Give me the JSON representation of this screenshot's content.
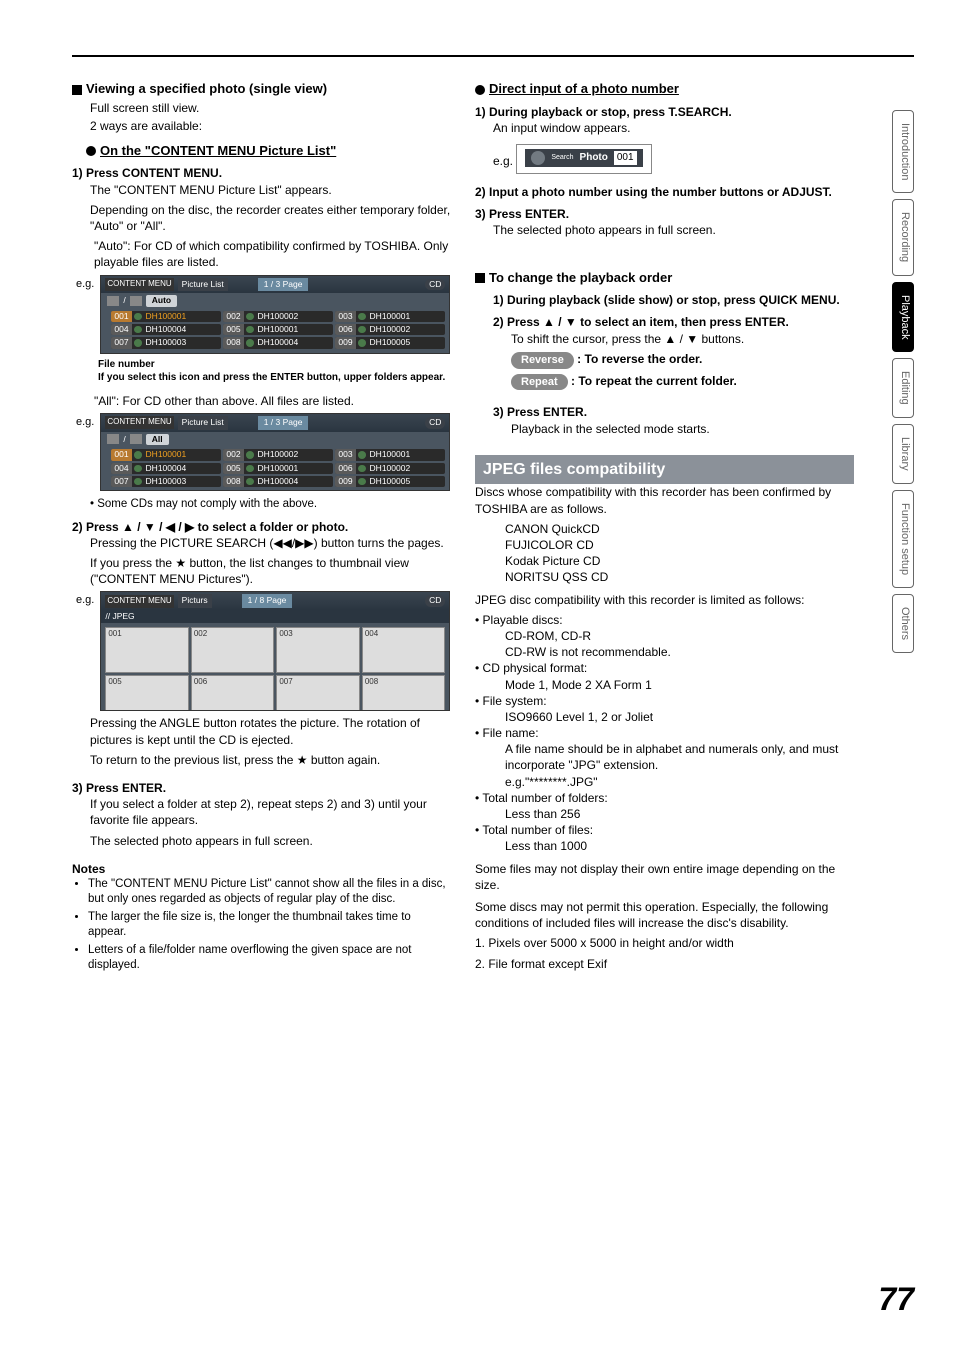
{
  "left": {
    "h_view": "Viewing a specified photo (single view)",
    "sub1": "Full screen still view.",
    "sub2": "2 ways are available:",
    "h_content": "On the \"CONTENT MENU Picture List\"",
    "s1_t": "1)  Press CONTENT MENU.",
    "s1_b1": "The \"CONTENT MENU Picture List\" appears.",
    "s1_b2": "Depending on the disc, the recorder creates either temporary folder, \"Auto\" or \"All\".",
    "s1_auto": "\"Auto\": For CD of which compatibility confirmed by TOSHIBA. Only playable files are listed.",
    "eg": "e.g.",
    "pl_corner": "CONTENT MENU",
    "pl_title": "Picture List",
    "pl_page": "1 / 3",
    "pl_page_lbl": "Page",
    "pl_cd": "CD",
    "pl_auto": "Auto",
    "cells_a": [
      {
        "n": "001",
        "name": "DH100001",
        "hl": true
      },
      {
        "n": "002",
        "name": "DH100002"
      },
      {
        "n": "003",
        "name": "DH100001"
      },
      {
        "n": "004",
        "name": "DH100004"
      },
      {
        "n": "005",
        "name": "DH100001"
      },
      {
        "n": "006",
        "name": "DH100002"
      },
      {
        "n": "007",
        "name": "DH100003"
      },
      {
        "n": "008",
        "name": "DH100004"
      },
      {
        "n": "009",
        "name": "DH100005"
      }
    ],
    "cap_fn": "File number",
    "cap_note": "If you select this icon and press the ENTER button, upper folders appear.",
    "s1_all": "\"All\":    For CD other than above. All files are listed.",
    "pl_all": "All",
    "cells_b": [
      {
        "n": "001",
        "name": "DH100001",
        "hl": true
      },
      {
        "n": "002",
        "name": "DH100002"
      },
      {
        "n": "003",
        "name": "DH100001"
      },
      {
        "n": "004",
        "name": "DH100004"
      },
      {
        "n": "005",
        "name": "DH100001"
      },
      {
        "n": "006",
        "name": "DH100002"
      },
      {
        "n": "007",
        "name": "DH100003"
      },
      {
        "n": "008",
        "name": "DH100004"
      },
      {
        "n": "009",
        "name": "DH100005"
      }
    ],
    "some_cds": "Some CDs may not comply with the above.",
    "s2_t": "2)  Press ▲ / ▼ / ◀ / ▶ to select a folder or photo.",
    "s2_b1": "Pressing the PICTURE SEARCH (◀◀/▶▶) button turns the pages.",
    "s2_b2": "If you press the ★ button, the list changes to thumbnail view (\"CONTENT MENU Pictures\").",
    "thumb_title": "Picturs",
    "thumb_page": "1 / 8",
    "thumb_sub": "JPEG",
    "thumbs": [
      "001",
      "002",
      "003",
      "004",
      "005",
      "006",
      "007",
      "008"
    ],
    "s2_b3": "Pressing the ANGLE button rotates the picture. The rotation of pictures is kept until the CD is ejected.",
    "s2_b4": "To return to the previous list, press the ★ button again.",
    "s3_t": "3)  Press ENTER.",
    "s3_b1": "If you select a folder at step 2), repeat steps 2) and 3) until your favorite file appears.",
    "s3_b2": "The selected photo appears in full screen.",
    "notes_h": "Notes",
    "notes": [
      "The \"CONTENT MENU Picture List\" cannot show all the files in a disc, but only ones regarded as objects of regular play of the disc.",
      "The larger the file size is, the longer the thumbnail takes time to appear.",
      "Letters of a file/folder name overflowing the given space are not displayed."
    ]
  },
  "right": {
    "h_direct": "Direct input of a photo number",
    "d1_t": "1)  During playback or stop, press T.SEARCH.",
    "d1_b": "An input window appears.",
    "search_lbl": "Search",
    "photo_lbl": "Photo",
    "photo_num": "001",
    "d2_t": "2)  Input a photo number using the number buttons or ADJUST.",
    "d3_t": "3)  Press ENTER.",
    "d3_b": "The selected photo appears in full screen.",
    "h_order": "To change the playback order",
    "o1_t": "1)  During playback (slide show) or stop, press QUICK MENU.",
    "o2_t": "2)  Press ▲ / ▼ to select an item, then press ENTER.",
    "o2_b": "To shift the cursor, press the ▲ / ▼ buttons.",
    "pill_rev": "Reverse",
    "pill_rev_d": ": To reverse the order.",
    "pill_rep": "Repeat",
    "pill_rep_d": ": To repeat the current folder.",
    "o3_t": "3)  Press ENTER.",
    "o3_b": "Playback in the selected mode starts.",
    "jpeg_h": "JPEG files compatibility",
    "jpeg_p1": "Discs whose compatibility with this recorder has been confirmed by TOSHIBA are as follows.",
    "jpeg_discs": [
      "CANON QuickCD",
      "FUJICOLOR CD",
      "Kodak Picture CD",
      "NORITSU QSS CD"
    ],
    "jpeg_p2": "JPEG disc compatibility with this recorder is limited as follows:",
    "jpeg_items": [
      {
        "h": "Playable discs:",
        "b": [
          "CD-ROM, CD-R",
          "CD-RW is not recommendable."
        ]
      },
      {
        "h": "CD physical format:",
        "b": [
          "Mode 1, Mode 2 XA Form 1"
        ]
      },
      {
        "h": "File system:",
        "b": [
          "ISO9660 Level 1, 2 or Joliet"
        ]
      },
      {
        "h": "File name:",
        "b": [
          "A file name should be in alphabet and numerals only, and must incorporate \"JPG\" extension.",
          "e.g.\"********.JPG\""
        ]
      },
      {
        "h": "Total number of folders:",
        "b": [
          "Less than 256"
        ]
      },
      {
        "h": "Total number of files:",
        "b": [
          "Less than 1000"
        ]
      }
    ],
    "jpeg_p3": "Some files may not display their own entire image depending on the size.",
    "jpeg_p4": "Some discs may not permit this operation. Especially, the following conditions of included files will increase the disc's disability.",
    "jpeg_c1": "1. Pixels over 5000 x 5000 in height and/or width",
    "jpeg_c2": "2. File format except Exif"
  },
  "tabs": [
    "Introduction",
    "Recording",
    "Playback",
    "Editing",
    "Library",
    "Function setup",
    "Others"
  ],
  "active_tab": 2,
  "page": "77"
}
